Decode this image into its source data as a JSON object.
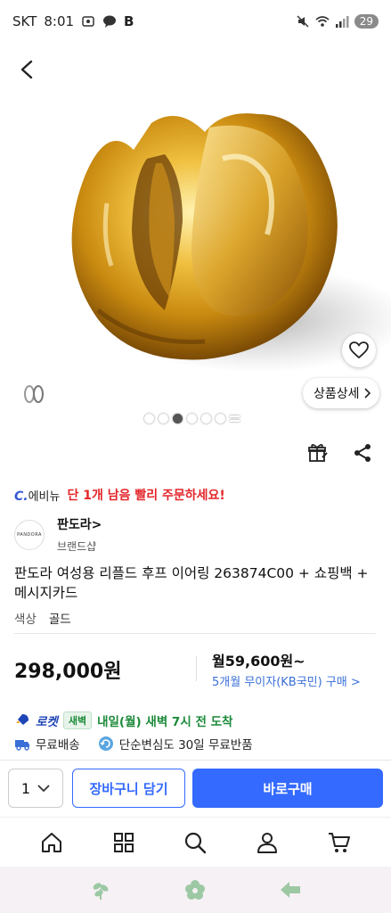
{
  "status": {
    "carrier": "SKT",
    "time": "8:01",
    "app_letter": "B",
    "battery": "29"
  },
  "product_detail_label": "상품상세",
  "promo": {
    "brand_c": "C.",
    "brand_text": "에비뉴",
    "message": "단 1개 남음 빨리 주문하세요!"
  },
  "seller": {
    "logo_text": "PANDORA",
    "name": "판도라>",
    "sub": "브랜드샵"
  },
  "product": {
    "title": "판도라 여성용 리플드 후프 이어링 263874C00 + 쇼핑백 + 메시지카드",
    "option_label": "색상",
    "option_value": "골드",
    "price": "298,000원",
    "monthly": "월59,600원~",
    "installment": "5개월 무이자(KB국민) 구매 >"
  },
  "delivery": {
    "rocket_logo": "로켓",
    "rocket_badge": "새벽",
    "eta": "내일(월) 새벽 7시 전 도착",
    "free_shipping": "무료배송",
    "free_return": "단순변심도 30일 무료반품"
  },
  "buy_bar": {
    "quantity": "1",
    "cart_label": "장바구니 담기",
    "buy_label": "바로구매"
  },
  "colors": {
    "accent": "#346aff",
    "alert": "#e4262a",
    "rocket_green": "#1d8a3a"
  },
  "icons": [
    "back-arrow-icon",
    "heart-icon",
    "gift-icon",
    "share-icon",
    "home-icon",
    "category-icon",
    "search-icon",
    "user-icon",
    "cart-icon"
  ]
}
